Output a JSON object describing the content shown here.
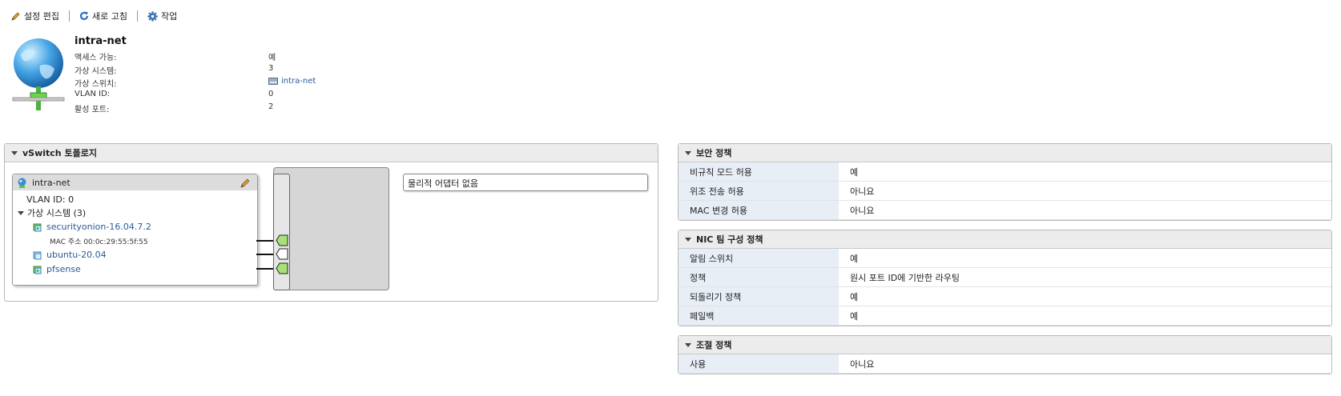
{
  "toolbar": {
    "edit_label": "설정 편집",
    "refresh_label": "새로 고침",
    "actions_label": "작업"
  },
  "header": {
    "title": "intra-net",
    "props": [
      {
        "label": "액세스 가능:",
        "value": "예"
      },
      {
        "label": "가상 시스템:",
        "value": "3"
      },
      {
        "label": "가상 스위치:",
        "value": "intra-net"
      },
      {
        "label": "VLAN ID:",
        "value": "0"
      },
      {
        "label": "활성 포트:",
        "value": "2"
      }
    ]
  },
  "topology": {
    "panel_title": "vSwitch 토폴로지",
    "portgroup": {
      "name": "intra-net",
      "vlan": "VLAN ID: 0",
      "vm_group_label": "가상 시스템 (3)",
      "vms": [
        {
          "name": "securityonion-16.04.7.2",
          "detail": "MAC 주소 00:0c:29:55:5f:55"
        },
        {
          "name": "ubuntu-20.04"
        },
        {
          "name": "pfsense"
        }
      ]
    },
    "adapter_label": "물리적 어댑터 없음"
  },
  "security_policy": {
    "title": "보안 정책",
    "rows": [
      {
        "key": "비규칙 모드 허용",
        "value": "예"
      },
      {
        "key": "위조 전송 허용",
        "value": "아니요"
      },
      {
        "key": "MAC 변경 허용",
        "value": "아니요"
      }
    ]
  },
  "nic_policy": {
    "title": "NIC 팀 구성 정책",
    "rows": [
      {
        "key": "알림 스위치",
        "value": "예"
      },
      {
        "key": "정책",
        "value": "원시 포트 ID에 기반한 라우팅"
      },
      {
        "key": "되돌리기 정책",
        "value": "예"
      },
      {
        "key": "페일백",
        "value": "예"
      }
    ]
  },
  "shaping_policy": {
    "title": "조절 정책",
    "rows": [
      {
        "key": "사용",
        "value": "아니요"
      }
    ]
  },
  "colors": {
    "link": "#2b5a9b",
    "port_active": "#a8e07a",
    "table_key_bg": "#e8eef6"
  }
}
